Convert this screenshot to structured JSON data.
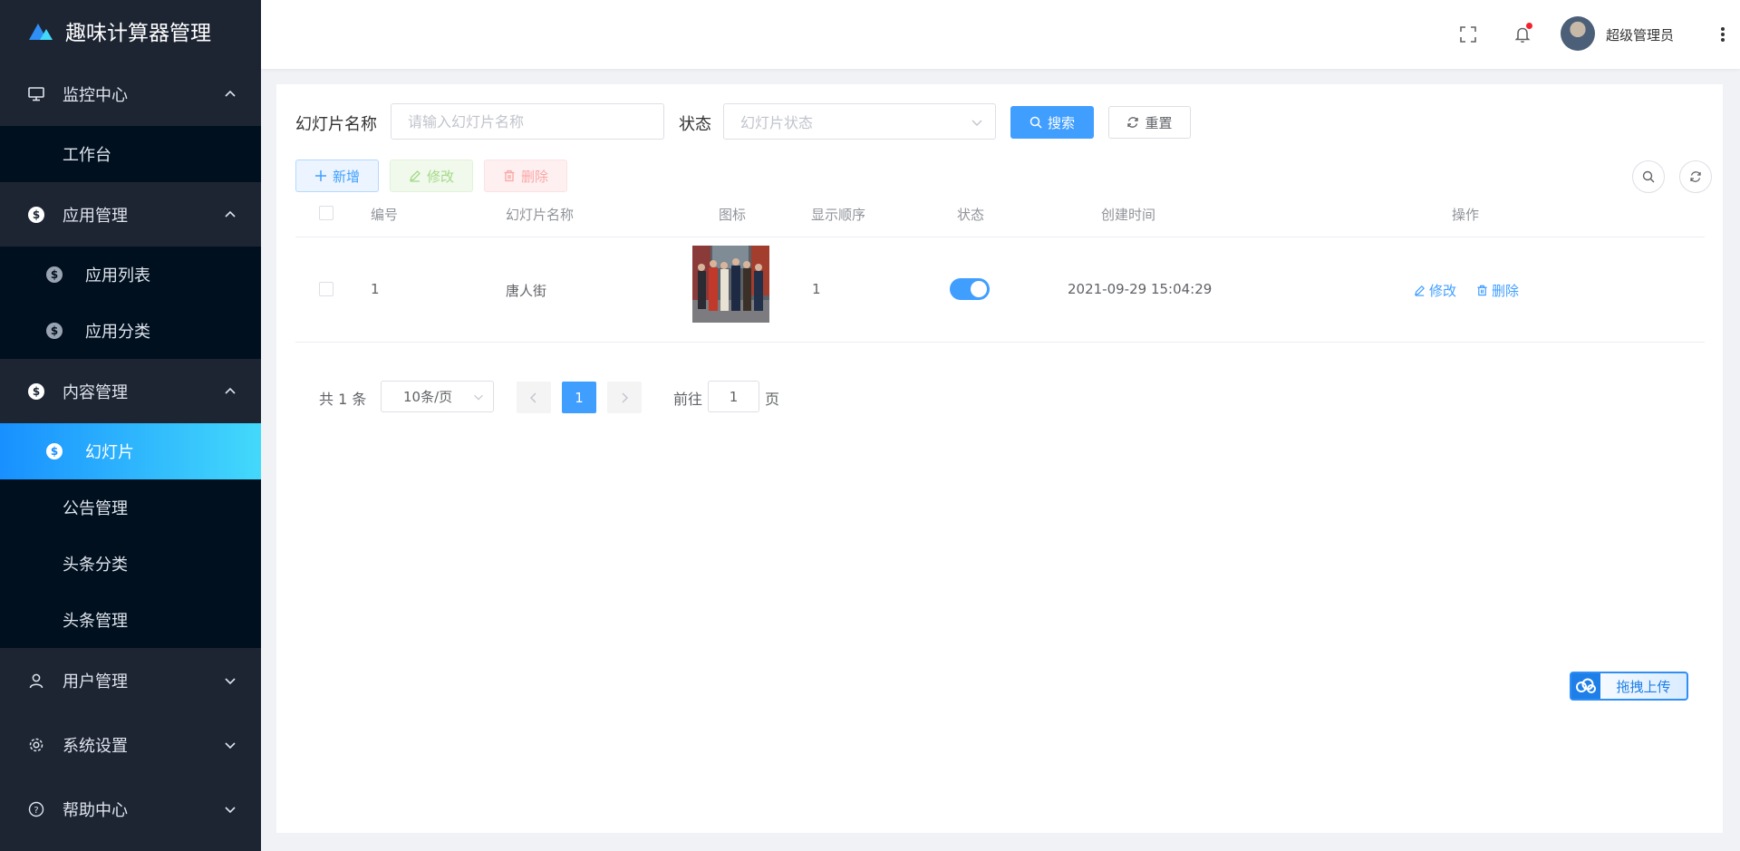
{
  "app": {
    "title": "趣味计算器管理"
  },
  "sidebar": {
    "groups": [
      {
        "label": "监控中心",
        "icon": "monitor-icon",
        "expanded": true,
        "items": [
          {
            "label": "工作台"
          }
        ]
      },
      {
        "label": "应用管理",
        "icon": "dollar-circle-icon",
        "expanded": true,
        "items": [
          {
            "label": "应用列表"
          },
          {
            "label": "应用分类"
          }
        ]
      },
      {
        "label": "内容管理",
        "icon": "dollar-circle-icon",
        "expanded": true,
        "items": [
          {
            "label": "幻灯片",
            "active": true
          },
          {
            "label": "公告管理"
          },
          {
            "label": "头条分类"
          },
          {
            "label": "头条管理"
          }
        ]
      },
      {
        "label": "用户管理",
        "icon": "user-icon",
        "expanded": false
      },
      {
        "label": "系统设置",
        "icon": "gear-icon",
        "expanded": false
      },
      {
        "label": "帮助中心",
        "icon": "help-circle-icon",
        "expanded": false
      }
    ]
  },
  "header": {
    "username": "超级管理员",
    "notification_unread": true
  },
  "search": {
    "name_label": "幻灯片名称",
    "name_placeholder": "请输入幻灯片名称",
    "status_label": "状态",
    "status_placeholder": "幻灯片状态",
    "search_button": "搜索",
    "reset_button": "重置"
  },
  "toolbar": {
    "add": "新增",
    "edit": "修改",
    "delete": "删除"
  },
  "table": {
    "columns": [
      "编号",
      "幻灯片名称",
      "图标",
      "显示顺序",
      "状态",
      "创建时间",
      "操作"
    ],
    "rows": [
      {
        "id": "1",
        "name": "唐人街",
        "order": "1",
        "status": true,
        "created": "2021-09-29 15:04:29",
        "actions": [
          "修改",
          "删除"
        ]
      }
    ]
  },
  "pagination": {
    "total_text": "共 1 条",
    "page_size": "10条/页",
    "current_page": "1",
    "goto_label": "前往",
    "goto_value": "1",
    "page_unit": "页"
  },
  "upload_widget": {
    "label": "拖拽上传"
  },
  "colors": {
    "sidebar_bg": "#1d2533",
    "submenu_bg": "#00101f",
    "primary": "#409eff",
    "active_gradient_start": "#1890ff",
    "active_gradient_end": "#43d9fb"
  }
}
